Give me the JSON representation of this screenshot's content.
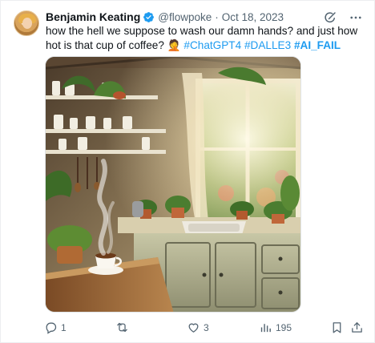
{
  "tweet": {
    "author_name": "Benjamin Keating",
    "handle": "@flowpoke",
    "separator": "·",
    "date": "Oct 18, 2023",
    "text_line1": "how the hell we suppose to wash our damn hands? and just how hot is that",
    "text_line2_prefix": "cup of coffee? ",
    "emoji": "🤦",
    "hashtags": [
      "#ChatGPT4",
      "#DALLE3",
      "#AI_FAIL"
    ]
  },
  "actions": {
    "replies": "1",
    "reposts": "",
    "likes": "3",
    "views": "195"
  },
  "icons": {
    "verified": "verified-badge-icon",
    "grok": "grok-icon",
    "more": "more-icon",
    "reply": "reply-icon",
    "repost": "repost-icon",
    "like": "heart-icon",
    "views": "views-icon",
    "bookmark": "bookmark-icon",
    "share": "share-icon"
  },
  "colors": {
    "accent": "#1d9bf0",
    "muted": "#536471",
    "text": "#0f1419"
  }
}
